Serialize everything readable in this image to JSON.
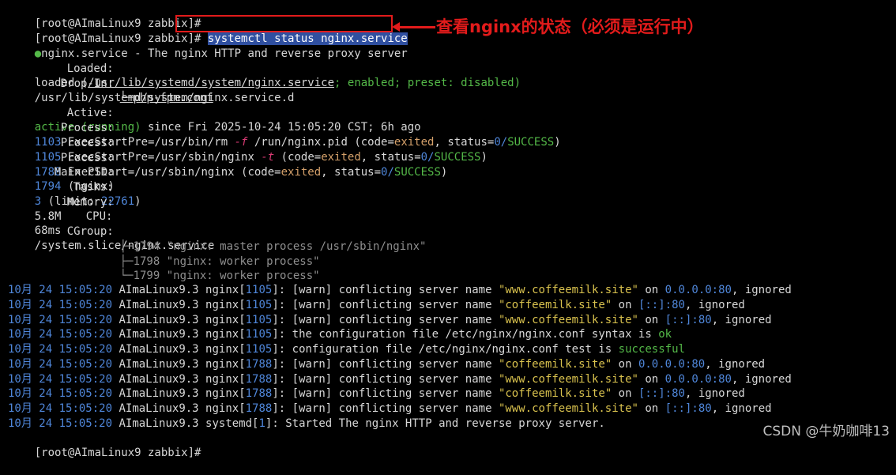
{
  "terminal": {
    "prompt": "[root@AImaLinux9 zabbix]# ",
    "command": "systemctl status nginx.service",
    "annotation": "查看nginx的状态（必须是运行中）",
    "service_title": "nginx.service - The nginx HTTP and reverse proxy server",
    "loaded": {
      "label": "Loaded:",
      "value": "loaded (",
      "path": "/usr/lib/systemd/system/nginx.service",
      "suffix": "; enabled; preset: disabled)"
    },
    "dropin": {
      "label": "Drop-In:",
      "value": "/usr/lib/systemd/system/nginx.service.d",
      "sub": "└─php-fpm.conf"
    },
    "active": {
      "label": "Active:",
      "value": "active (running)",
      "rest": " since Fri 2025-10-24 15:05:20 CST; 6h ago"
    },
    "processes": [
      {
        "label": "Process:",
        "pid": "1103",
        "text": " ExecStartPre=/usr/bin/rm ",
        "flag": "-f",
        "after": " /run/nginx.pid (code=",
        "code": "exited",
        ", status": ", status=",
        "status": "0/",
        "result": "SUCCESS",
        ")": ")"
      },
      {
        "label": "Process:",
        "pid": "1105",
        "text": " ExecStartPre=/usr/sbin/nginx ",
        "flag": "-t",
        "after": " (code=",
        "code": "exited",
        ", status": ", status=",
        "status": "0/",
        "result": "SUCCESS",
        ")": ")"
      },
      {
        "label": "Process:",
        "pid": "1788",
        "text": " ExecStart=/usr/sbin/nginx ",
        "flag": "",
        "after": "(code=",
        "code": "exited",
        ", status": ", status=",
        "status": "0/",
        "result": "SUCCESS",
        ")": ")"
      }
    ],
    "mainpid": {
      "label": "Main PID:",
      "pid": "1794",
      "rest": " (nginx)"
    },
    "tasks": {
      "label": "Tasks:",
      "value": "3",
      "rest": " (limit: ",
      "limit": "22761",
      ")": ")"
    },
    "memory": {
      "label": "Memory:",
      "value": "5.8M"
    },
    "cpu": {
      "label": "CPU:",
      "value": "68ms"
    },
    "cgroup": {
      "label": "CGroup:",
      "value": "/system.slice/nginx.service",
      "items": [
        {
          "tree": "├─",
          "pid": "1794",
          "cmd": "\"nginx: master process /usr/sbin/nginx\""
        },
        {
          "tree": "├─",
          "pid": "1798",
          "cmd": "\"nginx: worker process\""
        },
        {
          "tree": "└─",
          "pid": "1799",
          "cmd": "\"nginx: worker process\""
        }
      ]
    },
    "logs": [
      {
        "m": "10月",
        "d": "24",
        "t": "15:05:20",
        "host": "AImaLinux9.3 nginx",
        "pid": "1105",
        "msg": "[warn] conflicting server name ",
        "name": "\"www.coffeemilk.site\"",
        "on": " on ",
        "addr": "0.0.0.0:80",
        "tail": ", ignored"
      },
      {
        "m": "10月",
        "d": "24",
        "t": "15:05:20",
        "host": "AImaLinux9.3 nginx",
        "pid": "1105",
        "msg": "[warn] conflicting server name ",
        "name": "\"coffeemilk.site\"",
        "on": " on ",
        "addr": "[::]:80",
        "tail": ", ignored"
      },
      {
        "m": "10月",
        "d": "24",
        "t": "15:05:20",
        "host": "AImaLinux9.3 nginx",
        "pid": "1105",
        "msg": "[warn] conflicting server name ",
        "name": "\"www.coffeemilk.site\"",
        "on": " on ",
        "addr": "[::]:80",
        "tail": ", ignored"
      },
      {
        "m": "10月",
        "d": "24",
        "t": "15:05:20",
        "host": "AImaLinux9.3 nginx",
        "pid": "1105",
        "msg": "the configuration file /etc/nginx/nginx.conf syntax is ",
        "name": "",
        "on": "",
        "addr": "ok",
        "tail": ""
      },
      {
        "m": "10月",
        "d": "24",
        "t": "15:05:20",
        "host": "AImaLinux9.3 nginx",
        "pid": "1105",
        "msg": "configuration file /etc/nginx/nginx.conf test is ",
        "name": "",
        "on": "",
        "addr": "successful",
        "tail": ""
      },
      {
        "m": "10月",
        "d": "24",
        "t": "15:05:20",
        "host": "AImaLinux9.3 nginx",
        "pid": "1788",
        "msg": "[warn] conflicting server name ",
        "name": "\"coffeemilk.site\"",
        "on": " on ",
        "addr": "0.0.0.0:80",
        "tail": ", ignored"
      },
      {
        "m": "10月",
        "d": "24",
        "t": "15:05:20",
        "host": "AImaLinux9.3 nginx",
        "pid": "1788",
        "msg": "[warn] conflicting server name ",
        "name": "\"www.coffeemilk.site\"",
        "on": " on ",
        "addr": "0.0.0.0:80",
        "tail": ", ignored"
      },
      {
        "m": "10月",
        "d": "24",
        "t": "15:05:20",
        "host": "AImaLinux9.3 nginx",
        "pid": "1788",
        "msg": "[warn] conflicting server name ",
        "name": "\"coffeemilk.site\"",
        "on": " on ",
        "addr": "[::]:80",
        "tail": ", ignored"
      },
      {
        "m": "10月",
        "d": "24",
        "t": "15:05:20",
        "host": "AImaLinux9.3 nginx",
        "pid": "1788",
        "msg": "[warn] conflicting server name ",
        "name": "\"www.coffeemilk.site\"",
        "on": " on ",
        "addr": "[::]:80",
        "tail": ", ignored"
      },
      {
        "m": "10月",
        "d": "24",
        "t": "15:05:20",
        "host": "AImaLinux9.3 systemd",
        "pid": "1",
        "msg": "Started The nginx HTTP and reverse proxy server.",
        "name": "",
        "on": "",
        "addr": "",
        "tail": ""
      }
    ],
    "watermark": "CSDN @牛奶咖啡13"
  }
}
